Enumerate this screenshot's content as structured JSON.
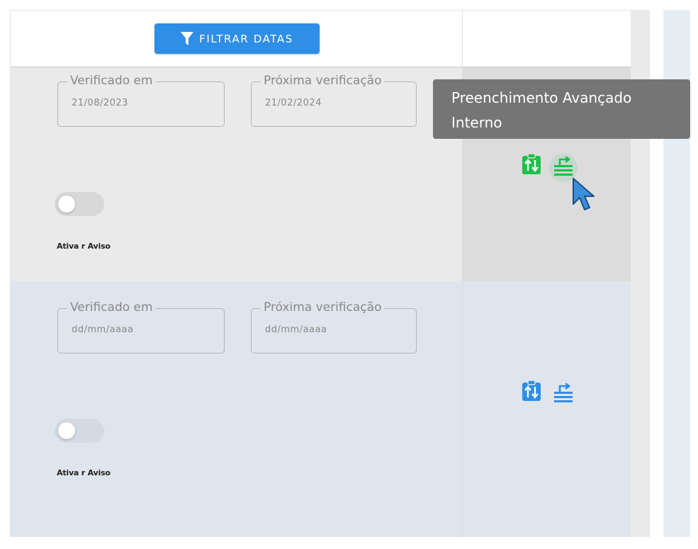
{
  "toolbar": {
    "filter_label": "FILTRAR DATAS",
    "filter_icon": "filter-icon"
  },
  "rows": [
    {
      "verified_label": "Verificado em",
      "verified_value": "21/08/2023",
      "next_label": "Próxima verificação",
      "next_value": "21/02/2024",
      "toggle_label": "Ativa r Aviso",
      "toggle_on": false,
      "icon_color": "#1fbf4a"
    },
    {
      "verified_label": "Verificado em",
      "verified_value": "dd/mm/aaaa",
      "next_label": "Próxima verificação",
      "next_value": "dd/mm/aaaa",
      "toggle_label": "Ativa r Aviso",
      "toggle_on": false,
      "icon_color": "#2f8ee6"
    }
  ],
  "tooltip": {
    "line1": "Preenchimento Avançado",
    "line2": "Interno"
  },
  "colors": {
    "accent": "#2f8ee6",
    "success": "#1fbf4a",
    "tooltip_bg": "#757575"
  }
}
